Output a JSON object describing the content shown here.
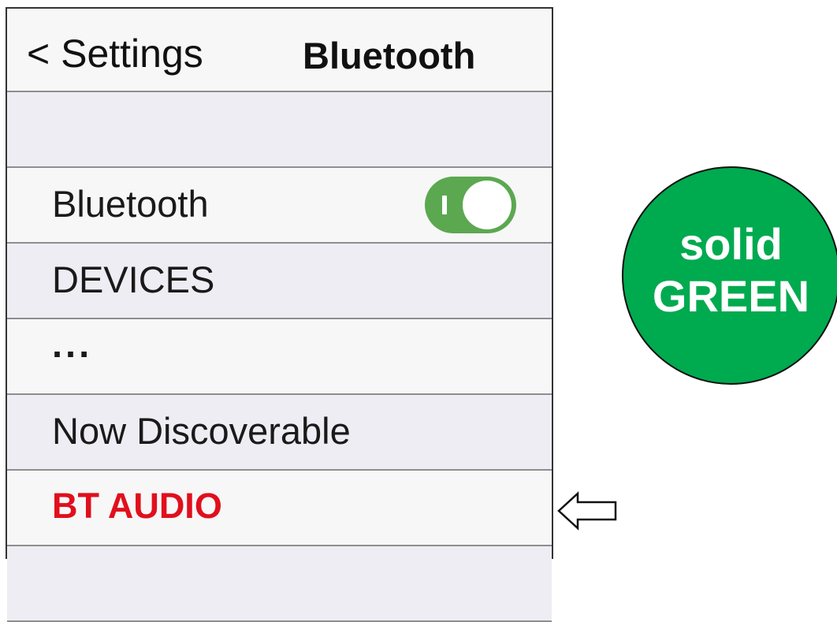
{
  "nav": {
    "back_label": "< Settings",
    "title": "Bluetooth"
  },
  "rows": [
    {
      "label": ""
    },
    {
      "label": "Bluetooth",
      "toggle_on": true
    },
    {
      "label": "DEVICES"
    },
    {
      "label": "..."
    },
    {
      "label": "Now Discoverable"
    },
    {
      "label": "BT AUDIO"
    }
  ],
  "indicator": {
    "line1": "solid",
    "line2": "GREEN",
    "color": "#00aa4f"
  },
  "colors": {
    "toggle_on": "#5ba850",
    "highlight_text": "#e10f1c"
  },
  "icons": {
    "pointer": "left-arrow-icon"
  }
}
